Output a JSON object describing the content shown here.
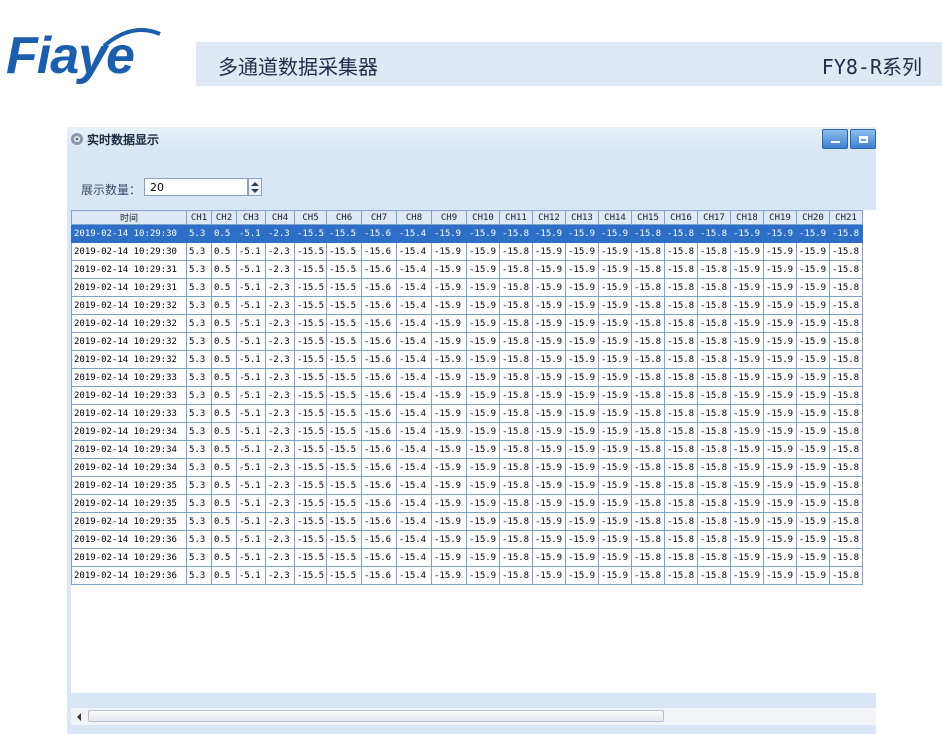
{
  "brochure": {
    "logo_text": "Fiaye",
    "product_title": "多通道数据采集器",
    "model_series": "FY8-R系列",
    "brand_color": "#1b5eac",
    "banner_color": "#dfe8f5"
  },
  "window": {
    "title": "实时数据显示",
    "icon": "gear-icon",
    "controls": [
      "minimize-icon",
      "maximize-icon"
    ]
  },
  "toolbar": {
    "count_label": "展示数量：",
    "count_value": "20"
  },
  "grid": {
    "headers": [
      "时间",
      "CH1",
      "CH2",
      "CH3",
      "CH4",
      "CH5",
      "CH6",
      "CH7",
      "CH8",
      "CH9",
      "CH10",
      "CH11",
      "CH12",
      "CH13",
      "CH14",
      "CH15",
      "CH16",
      "CH17",
      "CH18",
      "CH19",
      "CH20",
      "CH21"
    ],
    "channel_values": [
      "5.3",
      "0.5",
      "-5.1",
      "-2.3",
      "-15.5",
      "-15.5",
      "-15.6",
      "-15.4",
      "-15.9",
      "-15.9",
      "-15.8",
      "-15.9",
      "-15.9",
      "-15.9",
      "-15.8",
      "-15.8",
      "-15.8",
      "-15.9",
      "-15.9",
      "-15.9",
      "-15.8"
    ],
    "timestamps": [
      "2019-02-14 10:29:30",
      "2019-02-14 10:29:30",
      "2019-02-14 10:29:31",
      "2019-02-14 10:29:31",
      "2019-02-14 10:29:32",
      "2019-02-14 10:29:32",
      "2019-02-14 10:29:32",
      "2019-02-14 10:29:32",
      "2019-02-14 10:29:33",
      "2019-02-14 10:29:33",
      "2019-02-14 10:29:33",
      "2019-02-14 10:29:34",
      "2019-02-14 10:29:34",
      "2019-02-14 10:29:34",
      "2019-02-14 10:29:35",
      "2019-02-14 10:29:35",
      "2019-02-14 10:29:35",
      "2019-02-14 10:29:36",
      "2019-02-14 10:29:36",
      "2019-02-14 10:29:36"
    ],
    "selected_row": 0,
    "selection_color": "#2d6ec6"
  }
}
